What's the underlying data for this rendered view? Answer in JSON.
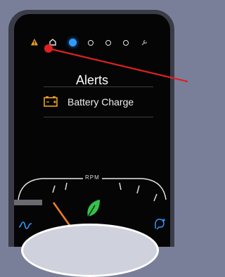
{
  "screen": {
    "title": "Alerts",
    "page_indicators": [
      {
        "icon": "warning-icon",
        "active": false
      },
      {
        "icon": "home-icon",
        "active": false
      },
      {
        "icon": "dot",
        "active": true
      },
      {
        "icon": "dot",
        "active": false
      },
      {
        "icon": "dot",
        "active": false
      },
      {
        "icon": "dot",
        "active": false
      },
      {
        "icon": "wrench-icon",
        "active": false
      }
    ],
    "alerts": [
      {
        "icon": "battery-icon",
        "label": "Battery Charge"
      }
    ]
  },
  "gauge": {
    "label": "RPM",
    "needle_color": "#f07a28",
    "eco_icon": "leaf-icon",
    "eco_color": "#33c24a"
  },
  "controls": {
    "left_icon": "wave-icon",
    "right_icon": "voice-assistant-icon"
  },
  "colors": {
    "accent": "#2e9bff",
    "warning": "#f0a020",
    "pointer": "#e02020"
  }
}
